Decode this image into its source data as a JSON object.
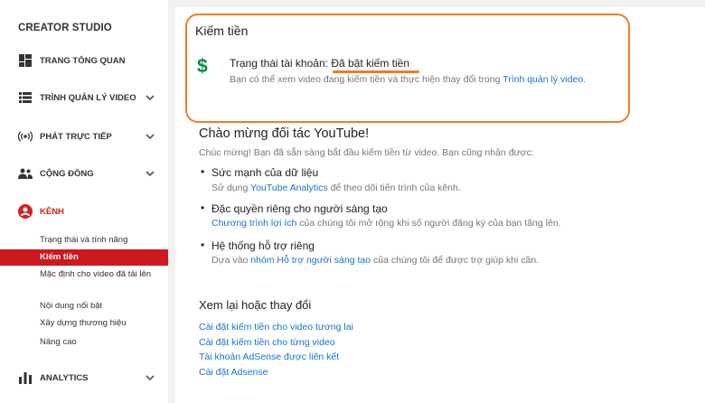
{
  "sidebar": {
    "brand": "CREATOR STUDIO",
    "items": [
      {
        "label": "TRANG TỔNG QUAN"
      },
      {
        "label": "TRÌNH QUẢN LÝ VIDEO"
      },
      {
        "label": "PHÁT TRỰC TIẾP"
      },
      {
        "label": "CỘNG ĐỒNG"
      },
      {
        "label": "KÊNH"
      },
      {
        "label": "ANALYTICS"
      }
    ],
    "channel_sub": [
      {
        "label": "Trạng thái và tính năng"
      },
      {
        "label": "Kiếm tiền"
      },
      {
        "label": "Mặc định cho video đã tải lên"
      },
      {
        "label": "Nội dung nổi bật"
      },
      {
        "label": "Xây dựng thương hiệu"
      },
      {
        "label": "Nâng cao"
      }
    ]
  },
  "monetization": {
    "title": "Kiếm tiền",
    "status_label": "Trạng thái tài khoản:",
    "status_value": "Đã bật kiếm tiền",
    "desc_prefix": "Bạn có thể xem video đang kiếm tiền và thực hiện thay đổi trong ",
    "desc_link": "Trình quản lý video",
    "desc_suffix": "."
  },
  "welcome": {
    "title": "Chào mừng đối tác YouTube!",
    "subtitle": "Chúc mừng! Bạn đã sẵn sàng bắt đầu kiếm tiền từ video. Bạn cũng nhận được:",
    "features": [
      {
        "title": "Sức mạnh của dữ liệu",
        "pre": "Sử dụng ",
        "link": "YouTube Analytics",
        "post": " để theo dõi tiến trình của kênh."
      },
      {
        "title": "Đặc quyền riêng cho người sáng tạo",
        "pre": "",
        "link": "Chương trình lợi ích",
        "post": " của chúng tôi mở rộng khi số người đăng ký của bạn tăng lên."
      },
      {
        "title": "Hệ thống hỗ trợ riêng",
        "pre": "Dựa vào ",
        "link": "nhóm Hỗ trợ người sáng tạo",
        "post": " của chúng tôi để được trợ giúp khi cần."
      }
    ]
  },
  "review": {
    "title": "Xem lại hoặc thay đổi",
    "links": [
      "Cài đặt kiếm tiền cho video tương lai",
      "Cài đặt kiếm tiền cho từng video",
      "Tài khoản AdSense được liên kết",
      "Cài đặt Adsense"
    ]
  },
  "colors": {
    "accent_red": "#cc181e",
    "highlight_orange": "#ef7d22",
    "link_blue": "#1a73c9",
    "dollar_green": "#0a8a3a"
  },
  "icons": [
    "dashboard-icon",
    "video-manager-icon",
    "live-stream-icon",
    "community-icon",
    "channel-icon",
    "analytics-icon",
    "chevron-down-icon",
    "dollar-icon"
  ]
}
